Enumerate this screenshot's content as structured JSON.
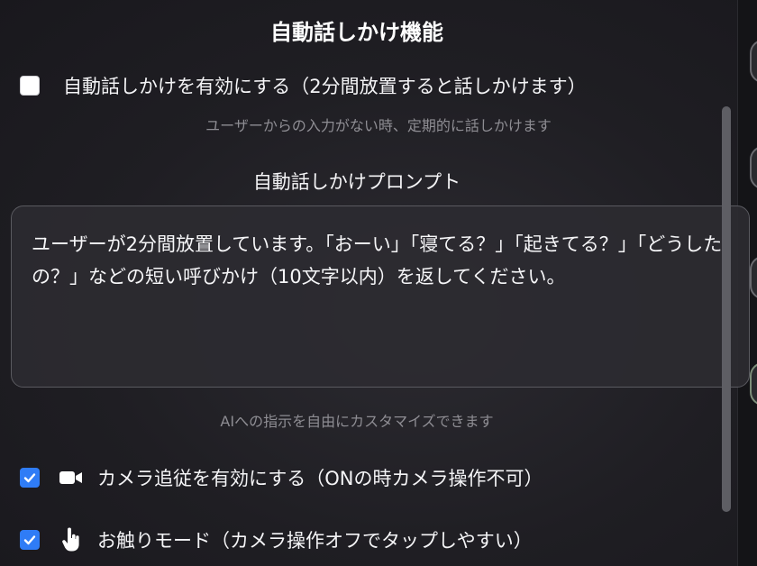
{
  "title": "自動話しかけ機能",
  "auto_talk": {
    "checkbox_label": "自動話しかけを有効にする（2分間放置すると話しかけます）",
    "checked": false,
    "hint": "ユーザーからの入力がない時、定期的に話しかけます"
  },
  "prompt_section": {
    "label": "自動話しかけプロンプト",
    "value": "ユーザーが2分間放置しています。「おーい」「寝てる？」「起きてる？」「どうしたの？」などの短い呼びかけ（10文字以内）を返してください。",
    "hint": "AIへの指示を自由にカスタマイズできます"
  },
  "camera_follow": {
    "label": "カメラ追従を有効にする（ONの時カメラ操作不可）",
    "checked": true,
    "icon": "video-camera-icon"
  },
  "touch_mode": {
    "label": "お触りモード（カメラ操作オフでタップしやすい）",
    "checked": true,
    "icon": "pointing-hand-icon"
  },
  "colors": {
    "accent": "#2f7cf6",
    "background": "#1d1c21",
    "hint_text": "#8e8d93"
  }
}
